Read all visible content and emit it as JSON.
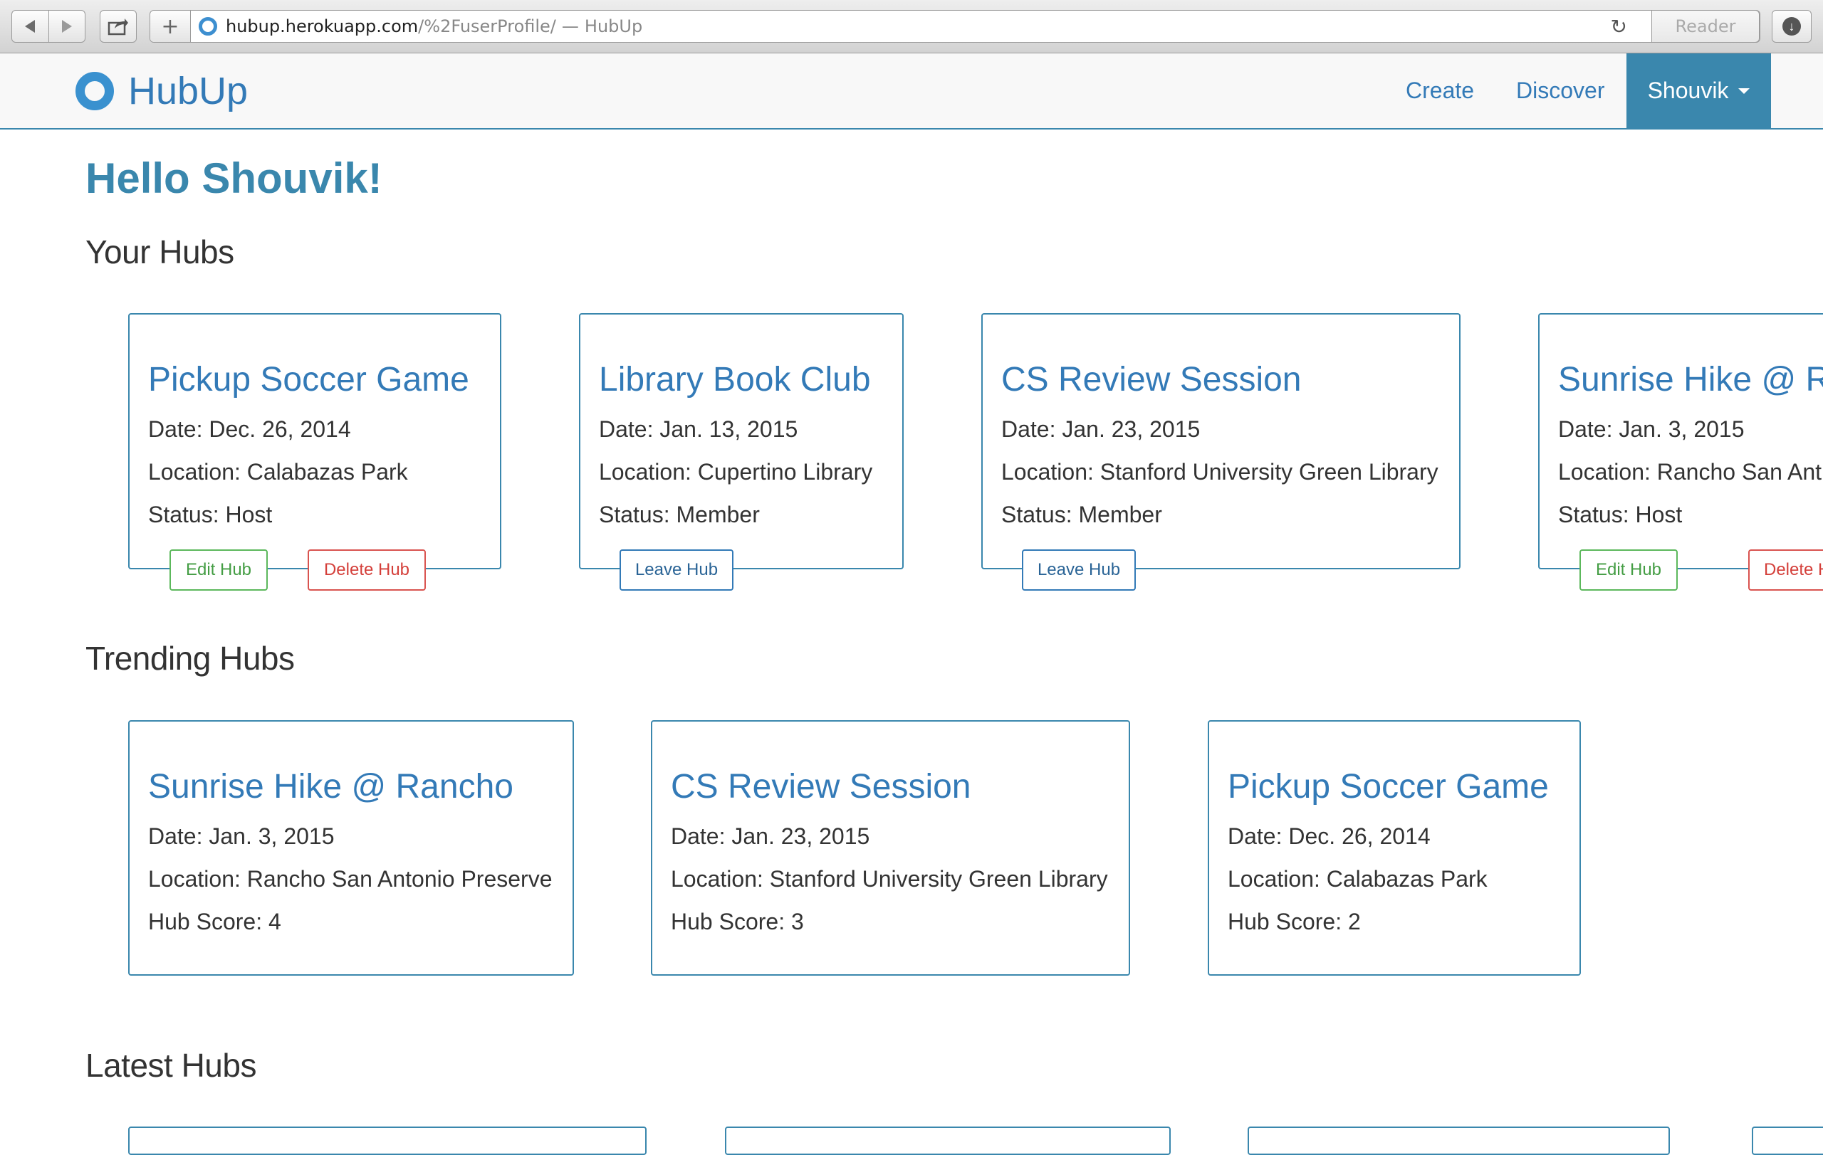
{
  "browser": {
    "url_host": "hubup.herokuapp.com",
    "url_path": "/%2FuserProfile/",
    "url_separator": "—",
    "page_title": "HubUp",
    "reader_label": "Reader",
    "icons": [
      "back-icon",
      "forward-icon",
      "share-icon",
      "new-tab-icon",
      "reload-icon",
      "download-icon"
    ]
  },
  "navbar": {
    "brand": "HubUp",
    "links": {
      "create": "Create",
      "discover": "Discover"
    },
    "user_menu": "Shouvik",
    "accent_color": "#3a87ad"
  },
  "greeting": "Hello Shouvik!",
  "your_hubs": {
    "title": "Your Hubs",
    "cards": [
      {
        "title": "Pickup Soccer Game",
        "date": "Date: Dec. 26, 2014",
        "location": "Location: Calabazas Park",
        "status": "Status: Host",
        "actions": [
          "Edit Hub",
          "Delete Hub"
        ]
      },
      {
        "title": "Library Book Club",
        "date": "Date: Jan. 13, 2015",
        "location": "Location: Cupertino Library",
        "status": "Status: Member",
        "actions": [
          "Leave Hub"
        ]
      },
      {
        "title": "CS Review Session",
        "date": "Date: Jan. 23, 2015",
        "location": "Location: Stanford University Green Library",
        "status": "Status: Member",
        "actions": [
          "Leave Hub"
        ]
      },
      {
        "title": "Sunrise Hike @ R",
        "date": "Date: Jan. 3, 2015",
        "location": "Location: Rancho San Ant",
        "status": "Status: Host",
        "actions": [
          "Edit Hub",
          "Delete H"
        ]
      }
    ]
  },
  "trending_hubs": {
    "title": "Trending Hubs",
    "cards": [
      {
        "title": "Sunrise Hike @ Rancho",
        "date": "Date: Jan. 3, 2015",
        "location": "Location: Rancho San Antonio Preserve",
        "score": "Hub Score: 4"
      },
      {
        "title": "CS Review Session",
        "date": "Date: Jan. 23, 2015",
        "location": "Location: Stanford University Green Library",
        "score": "Hub Score: 3"
      },
      {
        "title": "Pickup Soccer Game",
        "date": "Date: Dec. 26, 2014",
        "location": "Location: Calabazas Park",
        "score": "Hub Score: 2"
      }
    ]
  },
  "latest_hubs": {
    "title": "Latest Hubs"
  }
}
